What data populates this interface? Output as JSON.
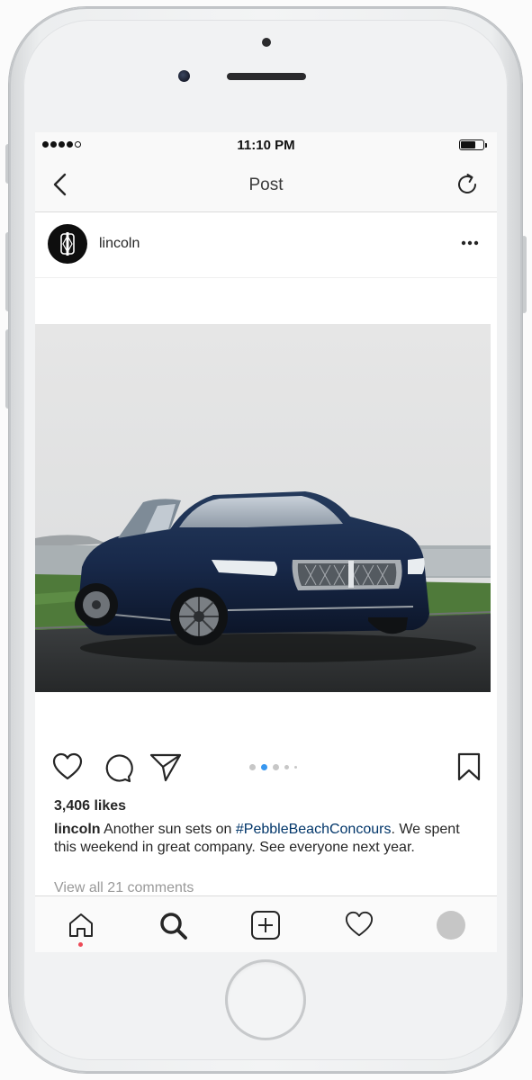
{
  "status_bar": {
    "time": "11:10 PM",
    "signal_bars_filled": 4,
    "signal_bars_total": 5,
    "battery_level": 0.7
  },
  "nav": {
    "title": "Post",
    "back_icon": "chevron-left-icon",
    "reload_icon": "reload-icon"
  },
  "post": {
    "username": "lincoln",
    "avatar_icon": "lincoln-logo-icon",
    "more_icon": "more-horizontal-icon",
    "image_subject": "dark blue Lincoln Continental sedan parked by the sea",
    "carousel": {
      "total": 5,
      "active_index": 1
    },
    "likes": "3,406 likes",
    "caption": {
      "username": "lincoln",
      "text_before": " Another sun sets on ",
      "hashtag": "#PebbleBeachConcours",
      "text_after": ". We spent this weekend in great company. See everyone next year."
    },
    "view_comments": "View all 21 comments"
  },
  "tabbar": {
    "items": [
      {
        "name": "home",
        "icon": "home-icon"
      },
      {
        "name": "search",
        "icon": "search-icon"
      },
      {
        "name": "add",
        "icon": "add-post-icon"
      },
      {
        "name": "activity",
        "icon": "heart-icon"
      },
      {
        "name": "profile",
        "icon": "profile-avatar-icon"
      }
    ]
  },
  "colors": {
    "hashtag": "#003569",
    "notification_dot": "#ed4956",
    "carousel_active": "#3897f0",
    "carousel_inactive": "#c7c7c7"
  }
}
